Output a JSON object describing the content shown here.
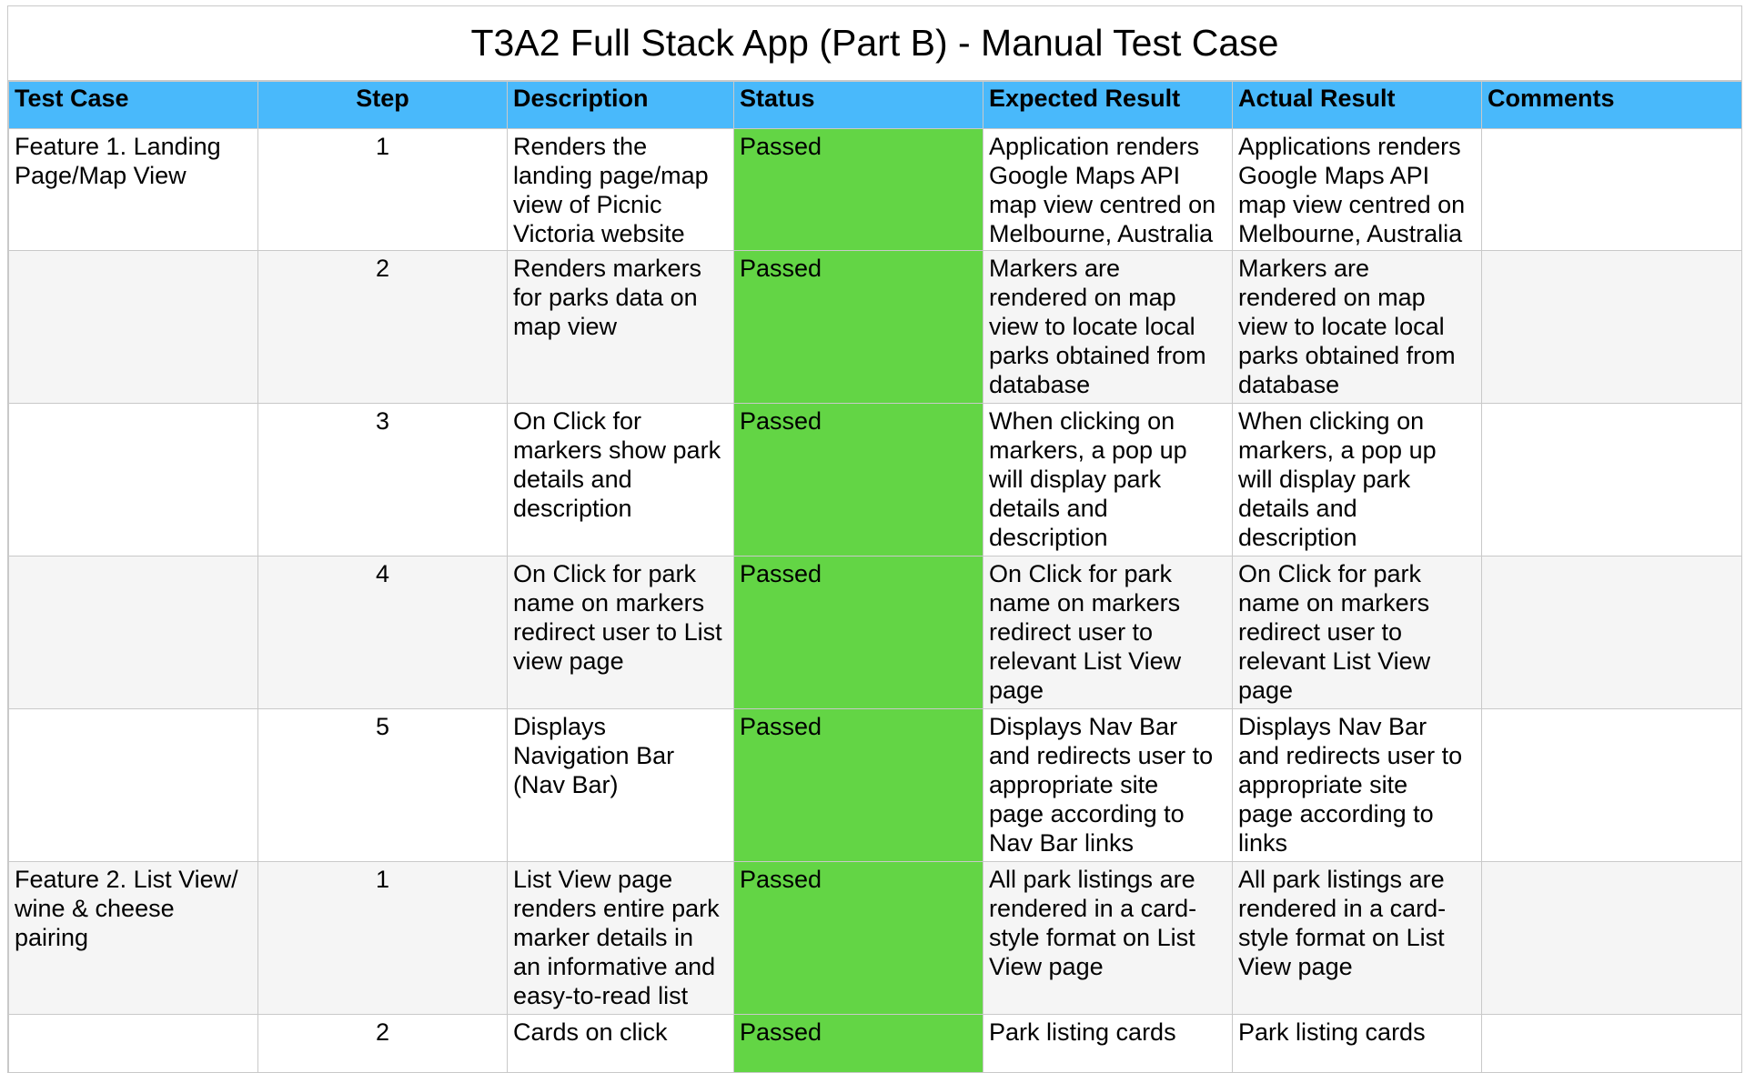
{
  "title": "T3A2 Full Stack App (Part B) - Manual Test Case",
  "colors": {
    "header_bg": "#49b9fb",
    "passed_bg": "#63d545",
    "alt_row_bg": "#f5f5f5",
    "grid_line": "#c9c9c9"
  },
  "headers": {
    "test_case": "Test Case",
    "step": "Step",
    "description": "Description",
    "status": "Status",
    "expected": "Expected Result",
    "actual": "Actual Result",
    "comments": "Comments"
  },
  "rows": [
    {
      "test_case": "Feature 1. Landing\nPage/Map View",
      "step": "1",
      "description": "Renders the\nlanding page/map\nview of Picnic\nVictoria website",
      "status": "Passed",
      "expected": "Application renders\nGoogle Maps API\nmap view centred on\nMelbourne, Australia",
      "actual": "Applications renders\nGoogle Maps API\nmap view centred on\nMelbourne, Australia",
      "comments": ""
    },
    {
      "test_case": "",
      "step": "2",
      "description": "Renders markers\nfor parks data on\nmap view",
      "status": "Passed",
      "expected": "Markers are\nrendered on map\nview to locate local\nparks obtained from\ndatabase",
      "actual": "Markers are\nrendered on map\nview to locate local\nparks obtained from\ndatabase",
      "comments": ""
    },
    {
      "test_case": "",
      "step": "3",
      "description": "On Click for\nmarkers show park\ndetails and\ndescription",
      "status": "Passed",
      "expected": "When clicking on\nmarkers, a pop up\nwill display park\ndetails and\ndescription",
      "actual": "When clicking on\nmarkers, a pop up\nwill display park\ndetails and\ndescription",
      "comments": ""
    },
    {
      "test_case": "",
      "step": "4",
      "description": "On Click for park\nname on markers\nredirect user to List\nview page",
      "status": "Passed",
      "expected": "On Click for park\nname on markers\nredirect user to\nrelevant List View\npage",
      "actual": "On Click for park\nname on markers\nredirect user to\nrelevant List View\npage",
      "comments": ""
    },
    {
      "test_case": "",
      "step": "5",
      "description": "Displays\nNavigation Bar\n(Nav Bar)",
      "status": "Passed",
      "expected": "Displays Nav Bar\nand redirects user to\nappropriate site\npage according to\nNav Bar links",
      "actual": "Displays Nav Bar\nand redirects user to\nappropriate site\npage according to\nlinks",
      "comments": ""
    },
    {
      "test_case": "Feature 2. List View/\nwine & cheese\npairing",
      "step": "1",
      "description": "List View page\nrenders entire park\nmarker details in\nan informative and\neasy-to-read list",
      "status": "Passed",
      "expected": "All park listings are\nrendered in a card-\nstyle format on List\nView page",
      "actual": "All park listings are\nrendered in a card-\nstyle format on List\nView page",
      "comments": ""
    },
    {
      "test_case": "",
      "step": "2",
      "description": "Cards on click",
      "status": "Passed",
      "expected": "Park listing cards",
      "actual": "Park listing cards",
      "comments": ""
    }
  ]
}
